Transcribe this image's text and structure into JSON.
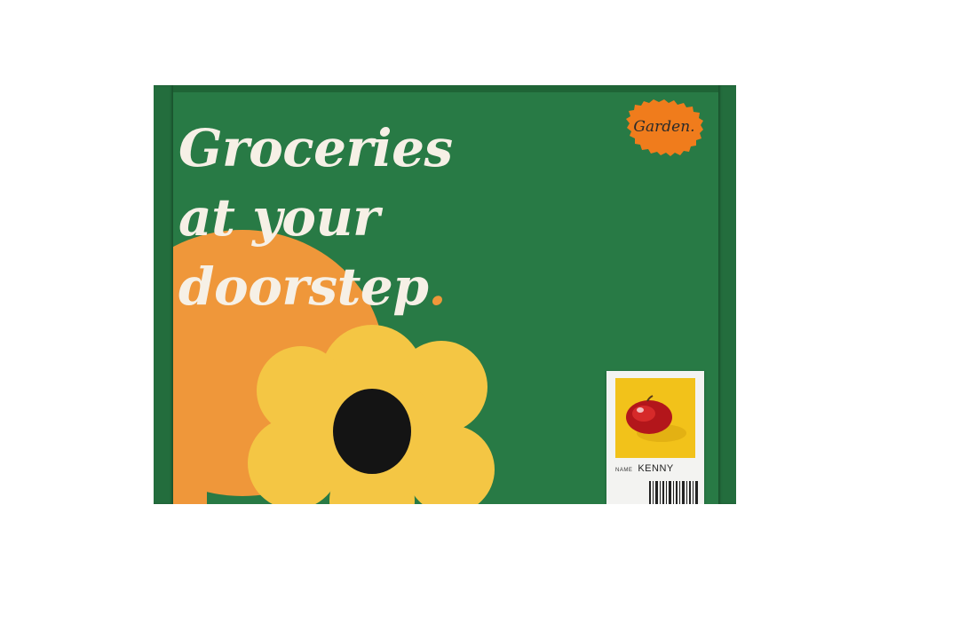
{
  "headline": {
    "line1": "Groceries",
    "line2": "at your",
    "line3": "doorstep",
    "period": "."
  },
  "brand": {
    "name": "Garden."
  },
  "label": {
    "name_caption": "NAME",
    "name_value": "KENNY"
  },
  "colors": {
    "box_green": "#287a45",
    "accent_orange": "#ef973a",
    "flower_yellow": "#f4c644",
    "cream_text": "#f6f0e6",
    "badge_orange": "#f07c1c"
  }
}
